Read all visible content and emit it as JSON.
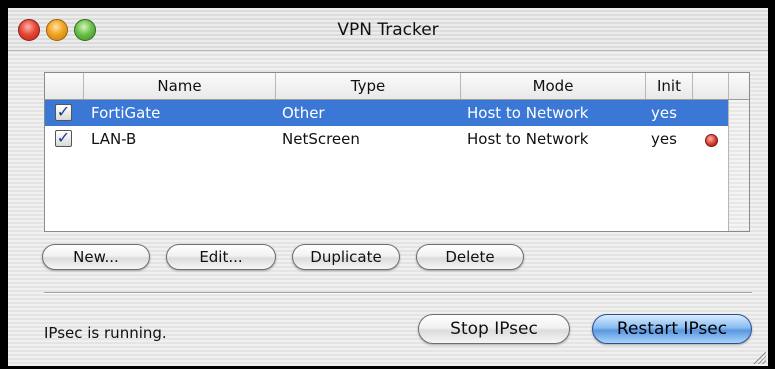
{
  "window": {
    "title": "VPN Tracker"
  },
  "table": {
    "columns": [
      "",
      "Name",
      "Type",
      "Mode",
      "Init"
    ],
    "rows": [
      {
        "enabled": true,
        "name": "FortiGate",
        "type": "Other",
        "mode": "Host to Network",
        "init": "yes",
        "selected": true,
        "status_icon": ""
      },
      {
        "enabled": true,
        "name": "LAN-B",
        "type": "NetScreen",
        "mode": "Host to Network",
        "init": "yes",
        "selected": false,
        "status_icon": "red-status-dot"
      }
    ]
  },
  "buttons": {
    "new": "New...",
    "edit": "Edit...",
    "duplicate": "Duplicate",
    "delete": "Delete",
    "stop": "Stop IPsec",
    "restart": "Restart IPsec"
  },
  "status": {
    "text": "IPsec is running."
  },
  "colors": {
    "selection": "#3b78d6",
    "default_button": "#5a97e0",
    "status_red": "#d93a2c"
  }
}
